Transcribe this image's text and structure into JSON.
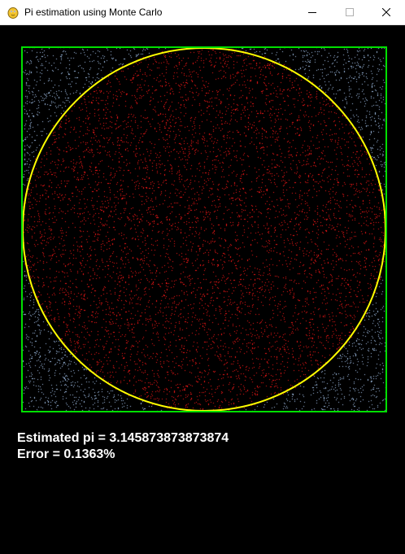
{
  "window": {
    "title": "Pi estimation using Monte Carlo",
    "icon": "pygame-snake-icon",
    "controls": [
      "minimize-icon",
      "maximize-icon",
      "close-icon"
    ]
  },
  "simulation": {
    "colors": {
      "background": "#000000",
      "inside_point": "#ff1a1a",
      "outside_point": "#a8c8f0",
      "circle_outline": "#ffff00",
      "square_outline": "#00e000"
    }
  },
  "results": {
    "estimate_line": "Estimated pi = 3.145873873873874",
    "error_line": "Error = 0.1363%"
  }
}
